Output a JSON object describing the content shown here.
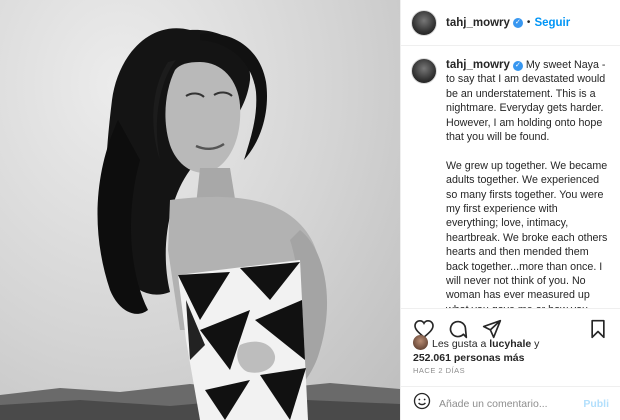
{
  "post": {
    "username": "tahj_mowry",
    "follow_label": "Seguir",
    "caption": {
      "username": "tahj_mowry",
      "first_line": "My sweet Naya - to say that I am devastated would be an understatement. This is a nightmare. Everyday gets harder. However, I am holding onto hope that you will be found.",
      "second_paragraph": "We grew up together. We became adults together. We experienced so many firsts together. You were my first experience with everything; love, intimacy, heartbreak. We broke each others hearts and then mended them back together...more than once. I will never not think of you. No woman has ever measured up what you gave me or how you made me feel. I've never liked to admit it but I have never stopped loving you. A part of me"
    },
    "likes": {
      "prefix": "Les gusta a",
      "liker": "lucyhale",
      "suffix": "y",
      "count": "252.061 personas más"
    },
    "time_ago": "HACE 2 DÍAS",
    "comment_placeholder": "Añade un comentario...",
    "publish_label": "Publi"
  },
  "icons": [
    "heart-icon",
    "comment-icon",
    "share-icon",
    "bookmark-icon",
    "emoji-icon"
  ]
}
